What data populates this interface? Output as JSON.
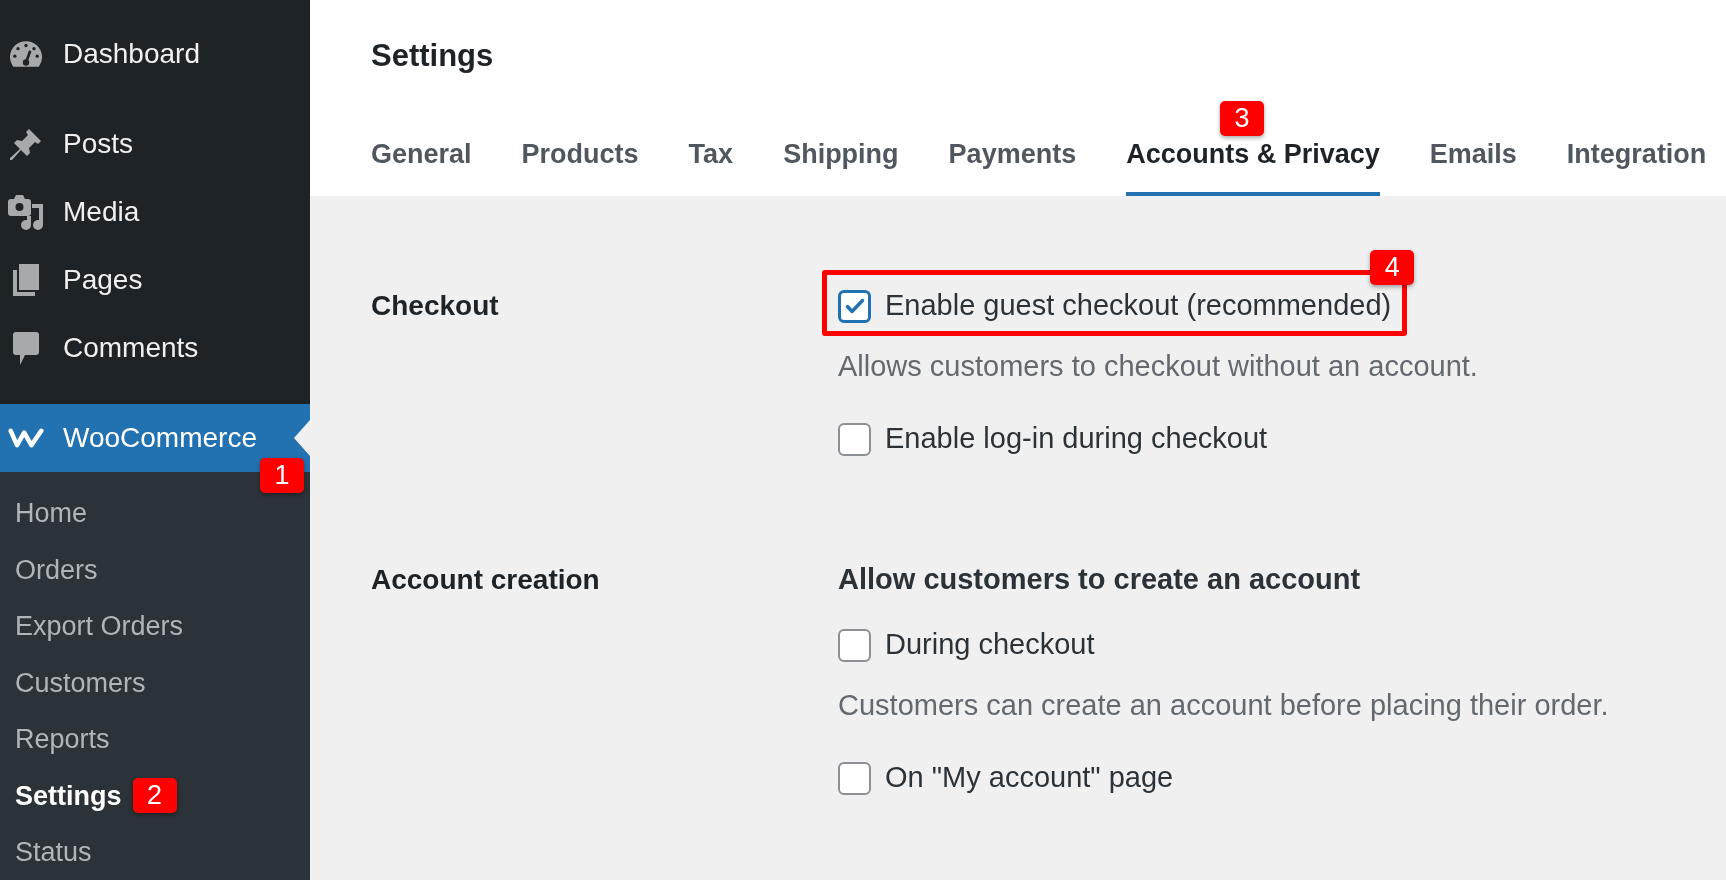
{
  "sidebar": {
    "menu_groups": [
      {
        "items": [
          {
            "label": "Dashboard",
            "selected": false
          }
        ]
      },
      {
        "items": [
          {
            "label": "Posts",
            "selected": false
          },
          {
            "label": "Media",
            "selected": false
          },
          {
            "label": "Pages",
            "selected": false
          },
          {
            "label": "Comments",
            "selected": false
          }
        ]
      },
      {
        "items": [
          {
            "label": "WooCommerce",
            "selected": true,
            "badge": "1",
            "children": [
              {
                "label": "Home",
                "selected": false
              },
              {
                "label": "Orders",
                "selected": false
              },
              {
                "label": "Export Orders",
                "selected": false
              },
              {
                "label": "Customers",
                "selected": false
              },
              {
                "label": "Reports",
                "selected": false
              },
              {
                "label": "Settings",
                "selected": true,
                "badge": "2"
              },
              {
                "label": "Status",
                "selected": false
              }
            ]
          }
        ]
      }
    ]
  },
  "page": {
    "title": "Settings",
    "tabs": [
      {
        "label": "General",
        "selected": false
      },
      {
        "label": "Products",
        "selected": false
      },
      {
        "label": "Tax",
        "selected": false
      },
      {
        "label": "Shipping",
        "selected": false
      },
      {
        "label": "Payments",
        "selected": false
      },
      {
        "label": "Accounts & Privacy",
        "selected": true,
        "badge": "3"
      },
      {
        "label": "Emails",
        "selected": false
      },
      {
        "label": "Integration",
        "selected": false
      }
    ],
    "sections": [
      {
        "label": "Checkout",
        "options": [
          {
            "kind": "checkbox",
            "label": "Enable guest checkout (recommended)",
            "checked": true,
            "highlighted": true,
            "badge": "4"
          },
          {
            "kind": "description",
            "text": "Allows customers to checkout without an account."
          },
          {
            "kind": "checkbox",
            "label": "Enable log-in during checkout",
            "checked": false,
            "highlighted": false
          }
        ]
      },
      {
        "label": "Account creation",
        "options": [
          {
            "kind": "heading",
            "text": "Allow customers to create an account"
          },
          {
            "kind": "checkbox",
            "label": "During checkout",
            "checked": false,
            "highlighted": false
          },
          {
            "kind": "description",
            "text": "Customers can create an account before placing their order."
          },
          {
            "kind": "checkbox",
            "label": "On \"My account\" page",
            "checked": false,
            "highlighted": false
          }
        ]
      }
    ]
  }
}
